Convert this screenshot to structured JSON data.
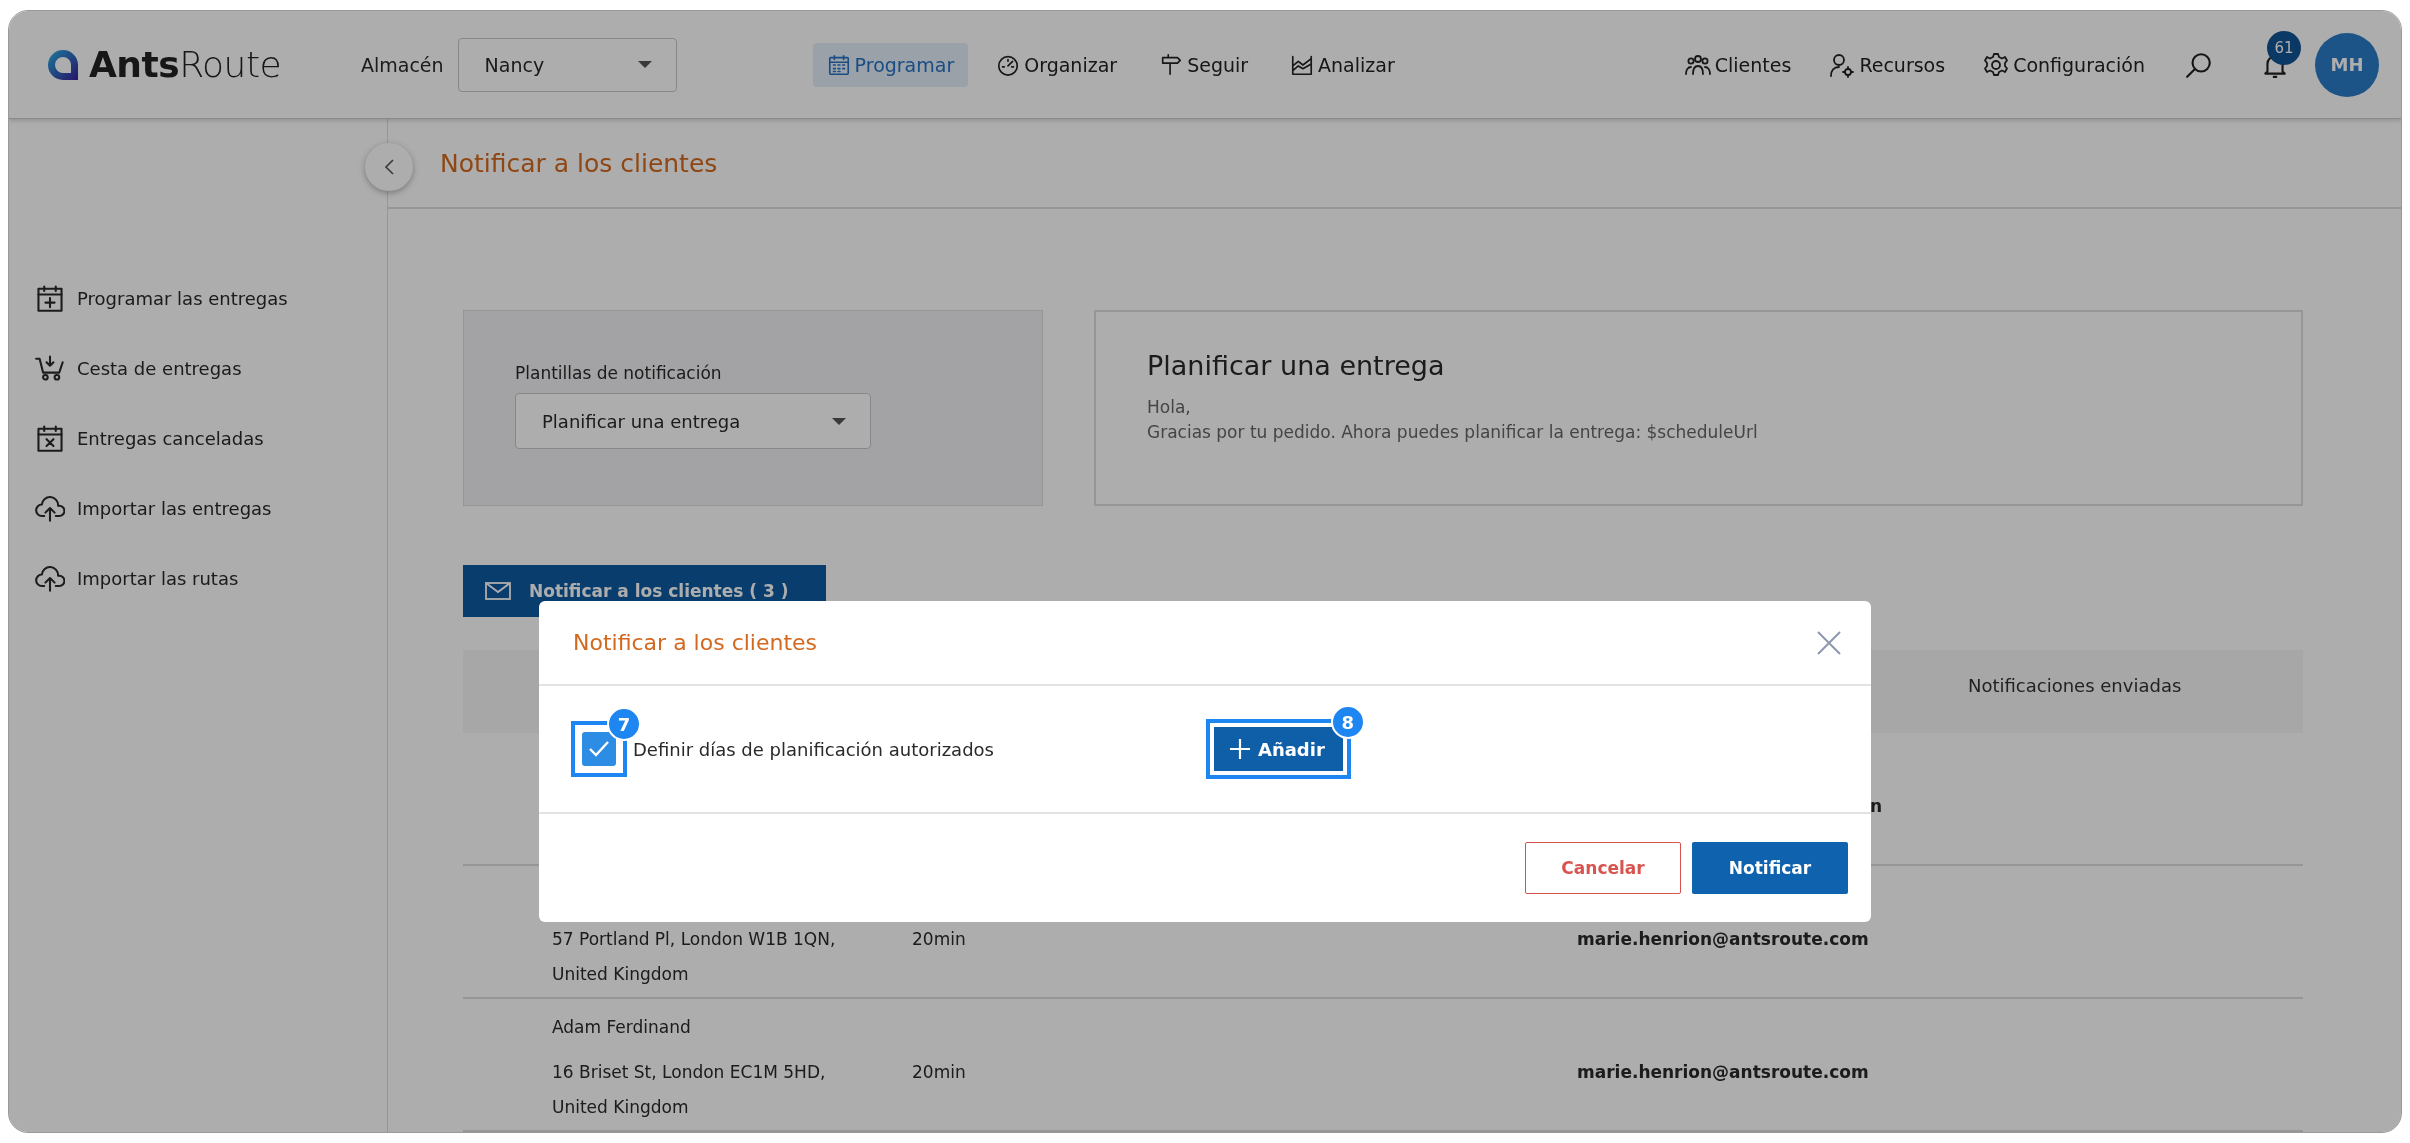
{
  "header": {
    "logo": {
      "bold": "Ants",
      "light": "Route"
    },
    "warehouse": {
      "label": "Almacén",
      "value": "Nancy"
    },
    "nav": [
      {
        "label": "Programar",
        "selected": true
      },
      {
        "label": "Organizar",
        "selected": false
      },
      {
        "label": "Seguir",
        "selected": false
      },
      {
        "label": "Analizar",
        "selected": false
      }
    ],
    "tools": [
      {
        "label": "Clientes"
      },
      {
        "label": "Recursos"
      },
      {
        "label": "Configuración"
      }
    ],
    "notifications": {
      "count": "61"
    },
    "avatar": {
      "initials": "MH"
    }
  },
  "sidebar": {
    "items": [
      {
        "label": "Programar las entregas"
      },
      {
        "label": "Cesta de entregas"
      },
      {
        "label": "Entregas canceladas"
      },
      {
        "label": "Importar las entregas"
      },
      {
        "label": "Importar las rutas"
      }
    ]
  },
  "page": {
    "title": "Notificar a los clientes",
    "templates": {
      "label": "Plantillas de notificación",
      "value": "Planificar una entrega"
    },
    "preview": {
      "title": "Planificar una entrega",
      "lines": [
        "Hola,",
        "Gracias por tu pedido. Ahora puedes planificar la entrega: $scheduleUrl"
      ]
    },
    "notify_button": "Notificar a los clientes ( 3 )",
    "table": {
      "columns": [
        {
          "label": "Notificaciones enviadas"
        }
      ],
      "rows": [
        {
          "email": "n"
        },
        {
          "address": "57 Portland Pl, London W1B 1QN, United Kingdom",
          "duration": "20min",
          "email": "marie.henrion@antsroute.com"
        },
        {
          "name": "Adam Ferdinand",
          "address": "16 Briset St, London EC1M 5HD, United Kingdom",
          "duration": "20min",
          "email": "marie.henrion@antsroute.com"
        }
      ]
    }
  },
  "dialog": {
    "title": "Notificar a los clientes",
    "option": {
      "label": "Definir días de planificación autorizados",
      "checked": true,
      "step": "7"
    },
    "add_button": {
      "label": "Añadir",
      "step": "8"
    },
    "buttons": [
      {
        "label": "Cancelar",
        "kind": "secondary"
      },
      {
        "label": "Notificar",
        "kind": "primary"
      }
    ]
  }
}
